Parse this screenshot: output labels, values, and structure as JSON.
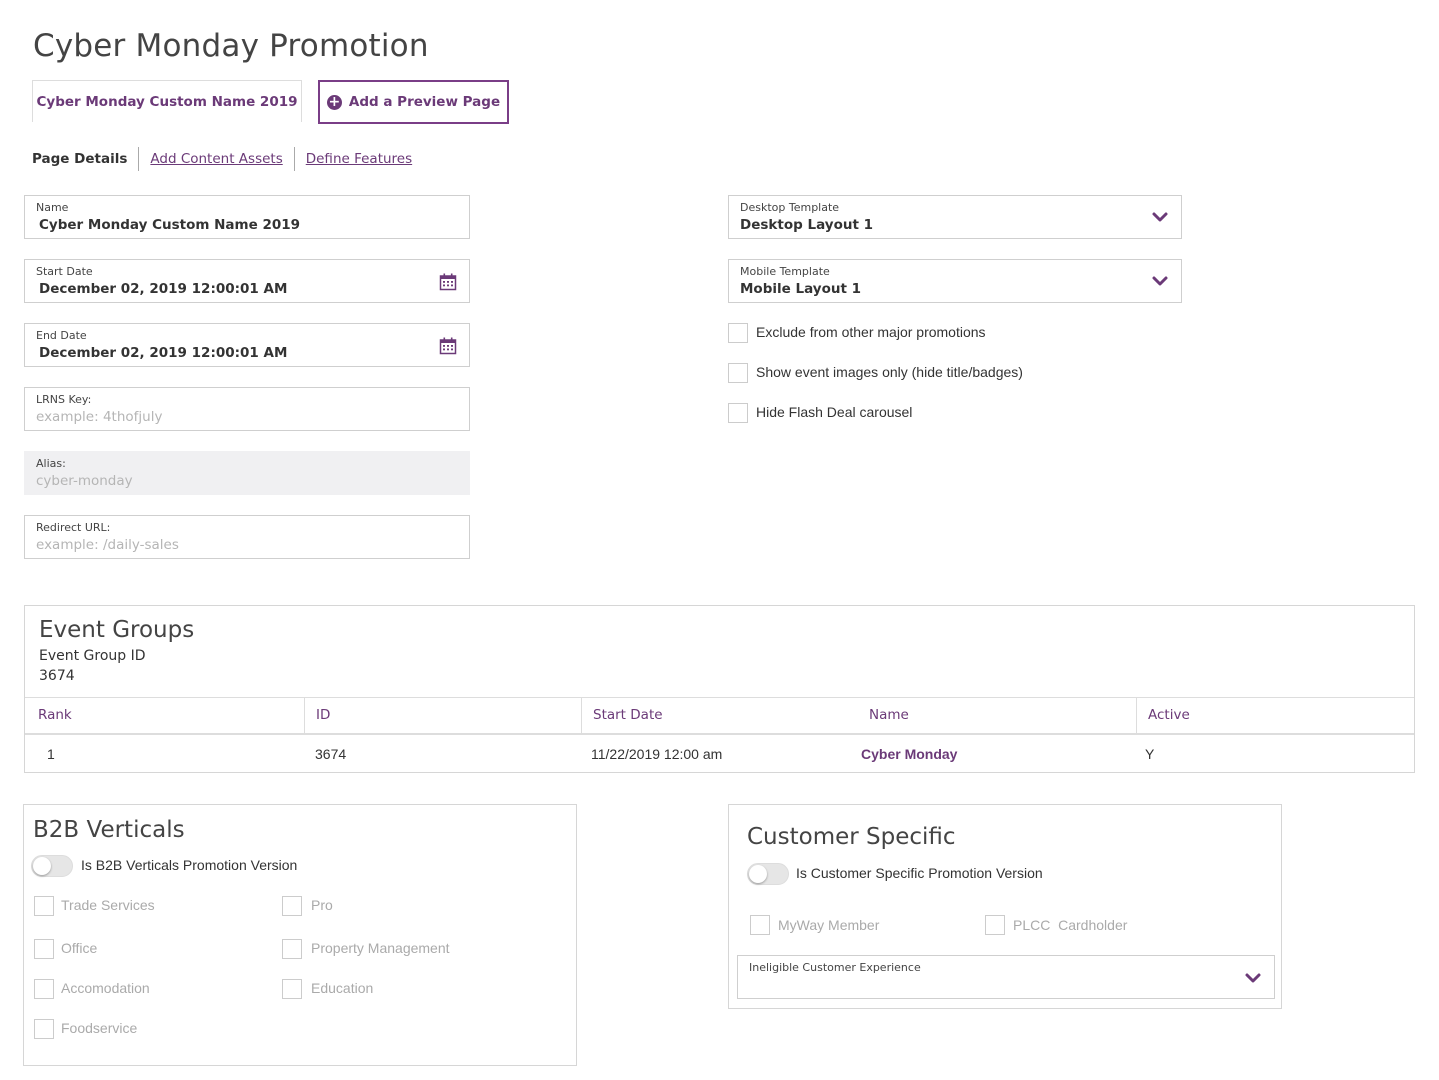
{
  "page": {
    "title": "Cyber Monday Promotion"
  },
  "tabs": {
    "active": "Cyber Monday Custom Name 2019",
    "add_preview": "Add a Preview Page"
  },
  "subnav": [
    "Page Details",
    "Add Content Assets",
    "Define Features"
  ],
  "form": {
    "name": {
      "label": "Name",
      "value": "Cyber Monday Custom Name 2019"
    },
    "start_date": {
      "label": "Start Date",
      "value": "December 02, 2019 12:00:01 AM"
    },
    "end_date": {
      "label": "End Date",
      "value": "December 02, 2019 12:00:01 AM"
    },
    "lrns_key": {
      "label": "LRNS Key:",
      "placeholder": "example: 4thofjuly"
    },
    "alias": {
      "label": "Alias:",
      "value": "cyber-monday"
    },
    "redirect_url": {
      "label": "Redirect URL:",
      "placeholder": "example: /daily-sales"
    },
    "desktop_template": {
      "label": "Desktop Template",
      "value": "Desktop Layout 1"
    },
    "mobile_template": {
      "label": "Mobile Template",
      "value": "Mobile Layout 1"
    },
    "options": [
      {
        "label": "Exclude from other major promotions",
        "checked": false
      },
      {
        "label": "Show event images only (hide title/badges)",
        "checked": false
      },
      {
        "label": "Hide Flash Deal carousel",
        "checked": false
      }
    ]
  },
  "event_groups": {
    "title": "Event Groups",
    "id_label": "Event Group ID",
    "id_value": "3674",
    "columns": [
      "Rank",
      "ID",
      "Start Date",
      "Name",
      "Active"
    ],
    "rows": [
      {
        "rank": "1",
        "id": "3674",
        "start_date": "11/22/2019 12:00 am",
        "name": "Cyber Monday",
        "active": "Y"
      }
    ]
  },
  "b2b": {
    "title": "B2B Verticals",
    "toggle_label": "Is B2B Verticals Promotion Version",
    "toggle_on": false,
    "options": [
      "Trade Services",
      "Pro",
      "Office",
      "Property Management",
      "Accomodation",
      "Education",
      "Foodservice"
    ]
  },
  "customer_specific": {
    "title": "Customer Specific",
    "toggle_label": "Is Customer Specific Promotion Version",
    "toggle_on": false,
    "options": [
      "MyWay Member",
      "PLCC  Cardholder"
    ],
    "ineligible_label": "Ineligible Customer Experience",
    "ineligible_value": ""
  },
  "colors": {
    "accent": "#6b3a78",
    "border": "#cfcfcf",
    "disabled_bg": "#f0f0f2"
  },
  "icons": {
    "calendar": "calendar-icon",
    "chevron": "chevron-down-icon",
    "plus": "plus-circle-icon"
  }
}
